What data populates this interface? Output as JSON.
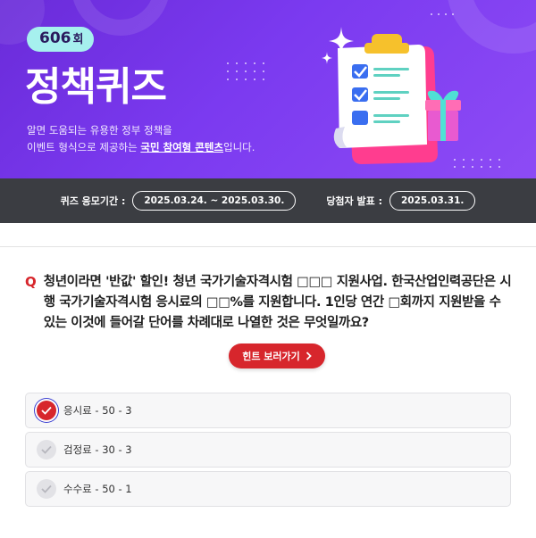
{
  "header": {
    "round_number": "606",
    "round_suffix": "회",
    "title": "정책퀴즈",
    "desc_line1": "알면 도움되는 유용한 정부 정책을",
    "desc_line2_prefix": "이벤트 형식으로 제공하는 ",
    "desc_line2_highlight": "국민 참여형 콘텐츠",
    "desc_line2_suffix": "입니다."
  },
  "period": {
    "entry_label": "퀴즈 응모기간 :",
    "entry_value": "2025.03.24. ~ 2025.03.30.",
    "announce_label": "당첨자 발표 :",
    "announce_value": "2025.03.31."
  },
  "quiz": {
    "q_mark": "Q",
    "question": "청년이라면 '반값' 할인! 청년 국가기술자격시험 □□□ 지원사업. 한국산업인력공단은 시행 국가기술자격시험 응시료의 □□%를 지원합니다. 1인당 연간 □회까지 지원받을 수 있는 이것에 들어갈 단어를 차례대로 나열한 것은 무엇일까요?",
    "hint_label": "힌트 보러가기",
    "options": [
      {
        "label": "응시료 - 50 - 3",
        "selected": true
      },
      {
        "label": "검정료 - 30 - 3",
        "selected": false
      },
      {
        "label": "수수료 - 50 - 1",
        "selected": false
      }
    ]
  },
  "colors": {
    "accent": "#d7262c",
    "hero_purple": "#7b3af0",
    "bar_dark": "#3b3d42"
  },
  "icons": [
    "sparkle-icon",
    "clipboard-checklist-icon",
    "gift-box-icon",
    "chevron-right-icon",
    "check-icon"
  ]
}
